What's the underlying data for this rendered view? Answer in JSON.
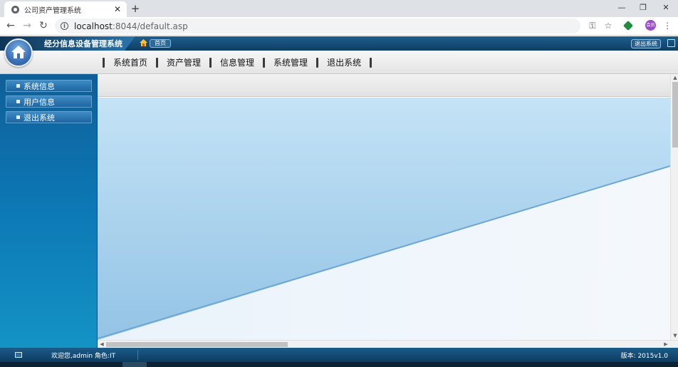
{
  "browser": {
    "tab_title": "公司资产管理系统",
    "url_host": "localhost",
    "url_rest": ":8044/default.asp",
    "avatar_text": "会员"
  },
  "header": {
    "system_title": "经分信息设备管理系统",
    "home_link": "首页",
    "logout_label": "退出系统"
  },
  "topnav": {
    "items": [
      "系统首页",
      "资产管理",
      "信息管理",
      "系统管理",
      "退出系统"
    ]
  },
  "sidebar": {
    "items": [
      "系统信息",
      "用户信息",
      "退出系统"
    ]
  },
  "footer": {
    "welcome": "欢迎您,admin 角色:IT",
    "version": "版本: 2015v1.0"
  },
  "colors": {
    "header_dark": "#0e3e63",
    "sidebar_blue": "#0c79b6",
    "content_sky": "#a9d3ee"
  }
}
